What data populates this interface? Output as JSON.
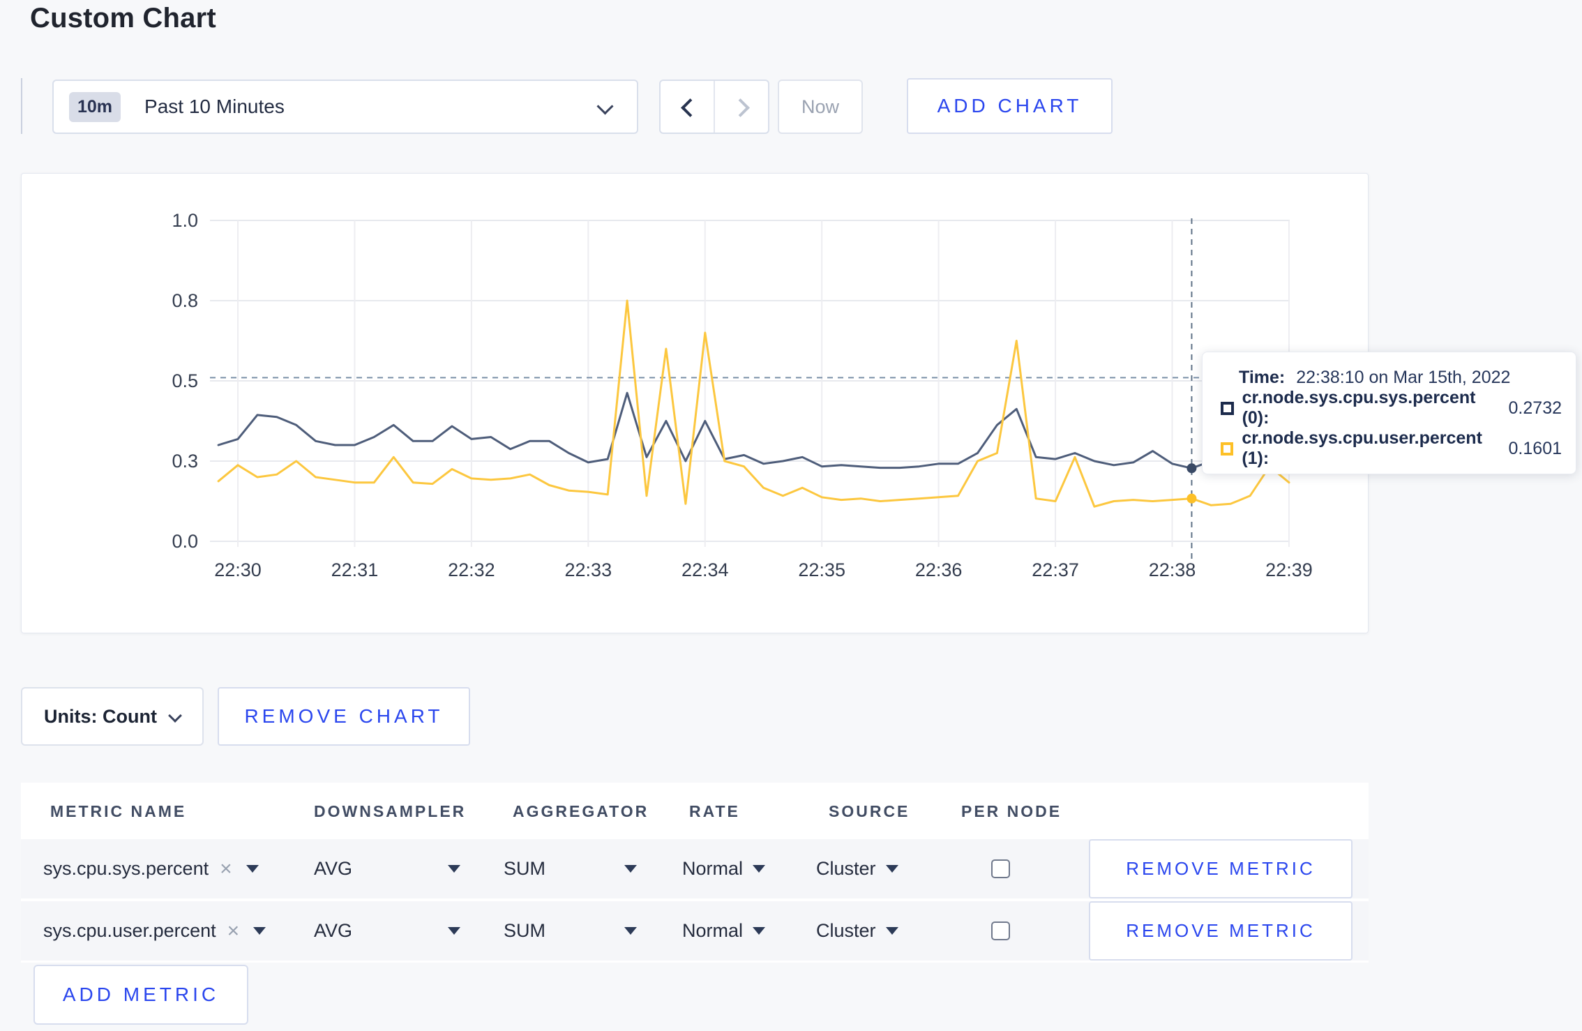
{
  "page": {
    "title": "Custom Chart"
  },
  "icons": {
    "close": "×",
    "chevron_down": "v",
    "chevron_left": "<",
    "chevron_right": ">"
  },
  "colors": {
    "accent": "#2a46ee",
    "page_bg": "#f7f8fa",
    "row_band": "#f5f6f9"
  },
  "controls": {
    "time_range_badge": "10m",
    "time_range_label": "Past 10 Minutes",
    "now_label": "Now",
    "add_chart_label": "ADD CHART"
  },
  "chart": {
    "units_label": "Units: Count",
    "remove_chart_label": "REMOVE CHART",
    "tooltip": {
      "time_label": "Time:",
      "time_value": "22:38:10 on Mar 15th, 2022",
      "rows": [
        {
          "label": "cr.node.sys.cpu.sys.percent (0):",
          "value": "0.2732",
          "color": "#1c2b4c"
        },
        {
          "label": "cr.node.sys.cpu.user.percent (1):",
          "value": "0.1601",
          "color": "#fdc027"
        }
      ]
    }
  },
  "chart_data": {
    "type": "line",
    "title": "",
    "xlabel": "",
    "ylabel": "",
    "grid": true,
    "legend_position": "none",
    "x_tick_labels": [
      "22:30",
      "22:31",
      "22:32",
      "22:33",
      "22:34",
      "22:35",
      "22:36",
      "22:37",
      "22:38",
      "22:39"
    ],
    "y_tick_values": [
      0.0,
      0.3,
      0.5,
      0.8,
      1.0
    ],
    "y_tick_labels": [
      "0.0",
      "0.3",
      "0.5",
      "0.8",
      "1.0"
    ],
    "x_start_time": "22:29:50",
    "x_step_seconds": 10,
    "crosshair": {
      "time": "22:38:10",
      "hover_value": 0.512
    },
    "series": [
      {
        "name": "cr.node.sys.cpu.sys.percent (0)",
        "color": "#4e5d7a",
        "values": [
          0.34,
          0.355,
          0.415,
          0.41,
          0.39,
          0.35,
          0.34,
          0.34,
          0.36,
          0.39,
          0.35,
          0.35,
          0.387,
          0.355,
          0.36,
          0.33,
          0.35,
          0.35,
          0.32,
          0.295,
          0.305,
          0.47,
          0.31,
          0.4,
          0.3,
          0.4,
          0.305,
          0.315,
          0.29,
          0.3,
          0.31,
          0.28,
          0.285,
          0.28,
          0.275,
          0.275,
          0.28,
          0.29,
          0.29,
          0.32,
          0.39,
          0.43,
          0.31,
          0.305,
          0.32,
          0.3,
          0.285,
          0.295,
          0.325,
          0.29,
          0.2732,
          0.3,
          0.295,
          0.3,
          0.315,
          0.3
        ]
      },
      {
        "name": "cr.node.sys.cpu.user.percent (1)",
        "color": "#fcc73f",
        "values": [
          0.225,
          0.285,
          0.24,
          0.25,
          0.3,
          0.24,
          0.23,
          0.22,
          0.22,
          0.31,
          0.22,
          0.215,
          0.27,
          0.235,
          0.23,
          0.235,
          0.25,
          0.21,
          0.19,
          0.185,
          0.175,
          0.8,
          0.17,
          0.62,
          0.14,
          0.68,
          0.3,
          0.28,
          0.2,
          0.17,
          0.2,
          0.165,
          0.155,
          0.16,
          0.15,
          0.155,
          0.16,
          0.165,
          0.17,
          0.3,
          0.32,
          0.65,
          0.16,
          0.15,
          0.31,
          0.13,
          0.15,
          0.155,
          0.15,
          0.155,
          0.1601,
          0.135,
          0.14,
          0.17,
          0.28,
          0.22
        ]
      }
    ]
  },
  "table": {
    "headers": [
      "METRIC NAME",
      "DOWNSAMPLER",
      "AGGREGATOR",
      "RATE",
      "SOURCE",
      "PER NODE"
    ],
    "rows": [
      {
        "metric_name": "sys.cpu.sys.percent",
        "downsampler": "AVG",
        "aggregator": "SUM",
        "rate": "Normal",
        "source": "Cluster",
        "per_node_checked": false,
        "remove_label": "REMOVE METRIC"
      },
      {
        "metric_name": "sys.cpu.user.percent",
        "downsampler": "AVG",
        "aggregator": "SUM",
        "rate": "Normal",
        "source": "Cluster",
        "per_node_checked": false,
        "remove_label": "REMOVE METRIC"
      }
    ],
    "add_metric_label": "ADD METRIC"
  }
}
